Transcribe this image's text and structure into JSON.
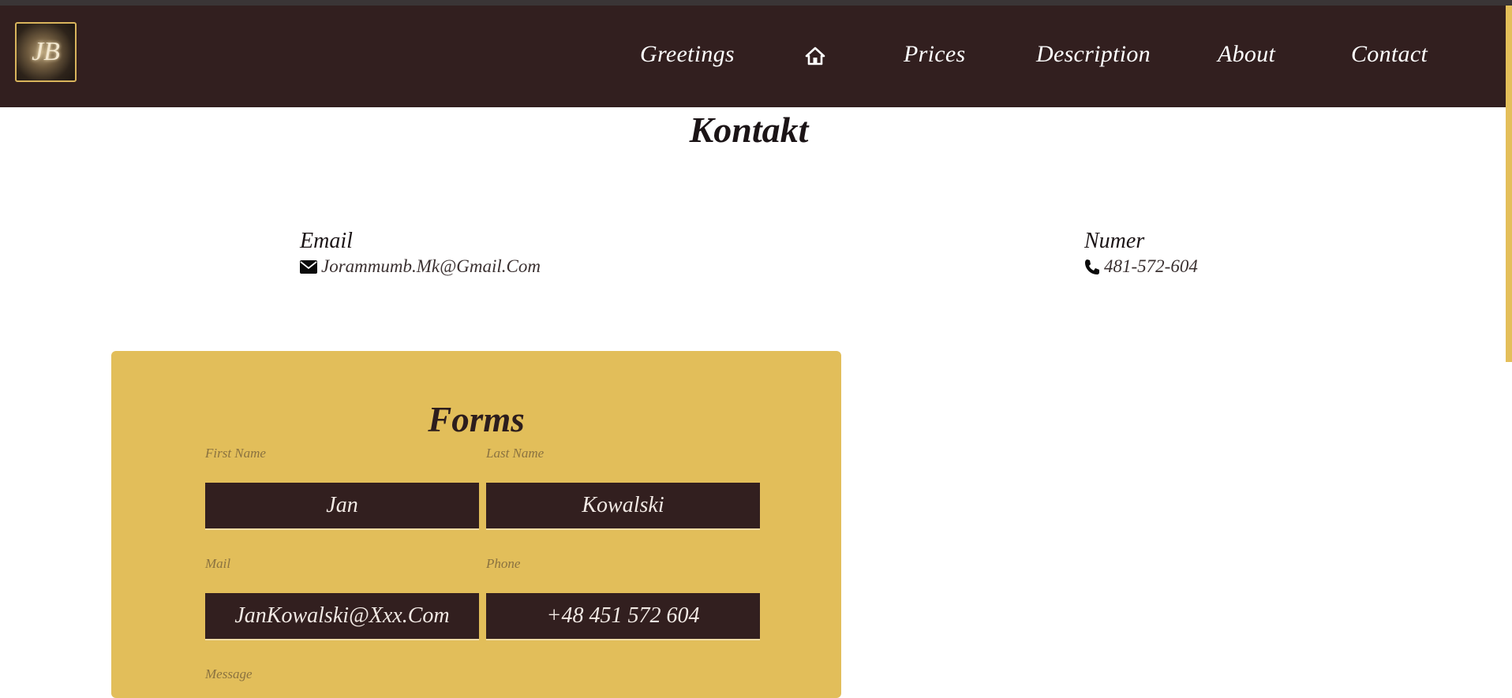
{
  "nav": {
    "logo_alt": "JB",
    "items": [
      {
        "label": "Greetings"
      },
      {
        "label": "Prices"
      },
      {
        "label": "Description"
      },
      {
        "label": "About"
      },
      {
        "label": "Contact"
      }
    ],
    "home_icon": "home-icon"
  },
  "page": {
    "title": "Kontakt"
  },
  "contact": {
    "email": {
      "label": "Email",
      "icon": "envelope-icon",
      "value": "Jorammumb.Mk@Gmail.Com"
    },
    "phone": {
      "label": "Numer",
      "icon": "phone-icon",
      "value": "481-572-604"
    }
  },
  "form": {
    "title": "Forms",
    "fields": {
      "first_name": {
        "label": "First Name",
        "value": "Jan"
      },
      "last_name": {
        "label": "Last Name",
        "value": "Kowalski"
      },
      "mail": {
        "label": "Mail",
        "value": "JanKowalski@Xxx.Com"
      },
      "phone": {
        "label": "Phone",
        "value": "+48 451 572 604"
      },
      "message": {
        "label": "Message"
      }
    }
  },
  "colors": {
    "navbar": "#321f1f",
    "accent": "#e2be5a",
    "input_bg": "#321f1f"
  }
}
